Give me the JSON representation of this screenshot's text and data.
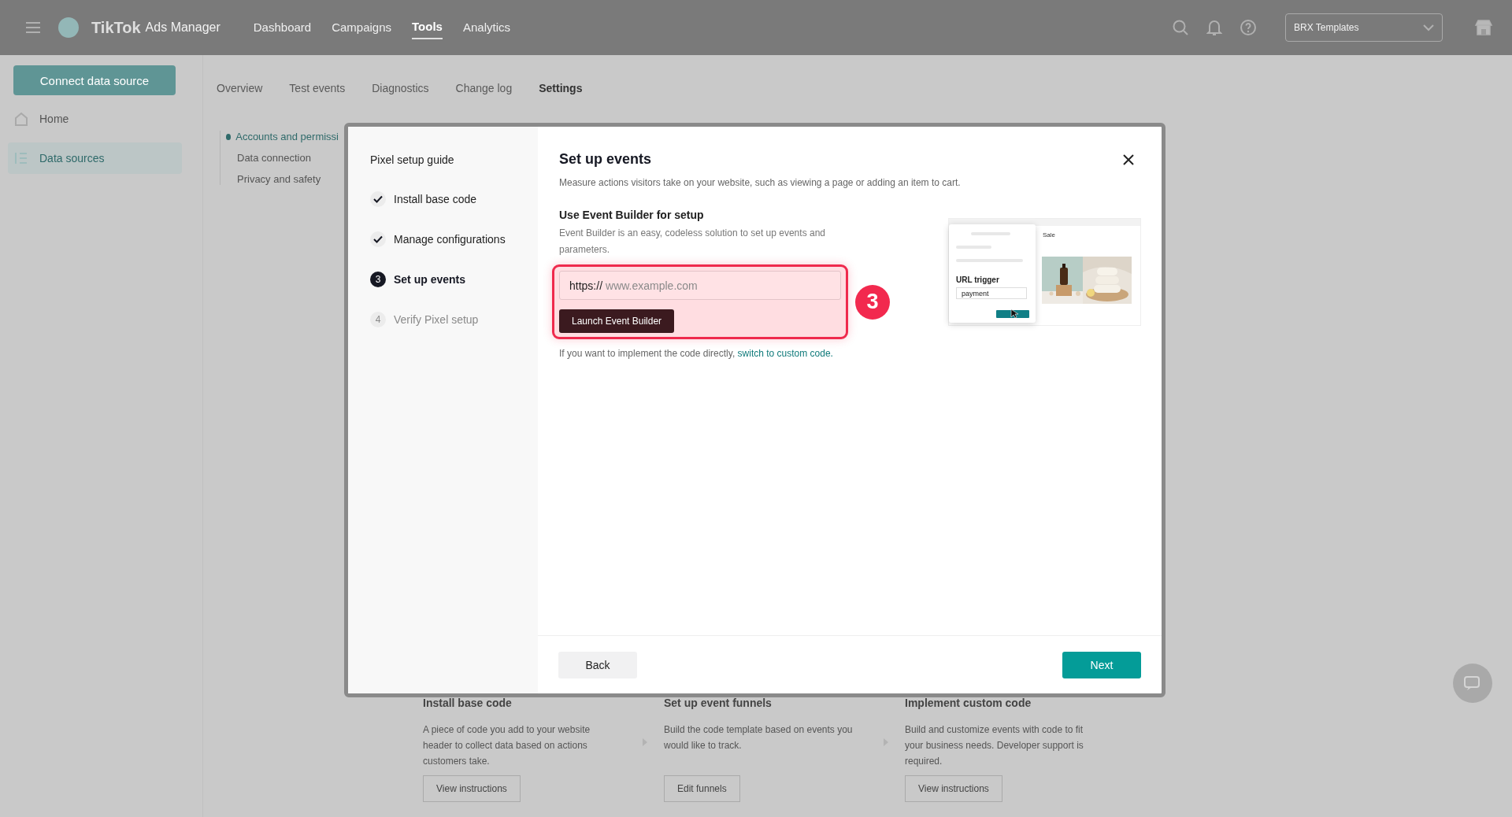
{
  "topbar": {
    "logo": "TikTok",
    "product": "Ads Manager",
    "nav": [
      {
        "label": "Dashboard",
        "selected": false
      },
      {
        "label": "Campaigns",
        "selected": false
      },
      {
        "label": "Tools",
        "selected": true
      },
      {
        "label": "Analytics",
        "selected": false
      }
    ],
    "account": "BRX Templates"
  },
  "subbar": {
    "connect_button": "Connect data source",
    "tabs": [
      {
        "label": "Overview",
        "selected": false
      },
      {
        "label": "Test events",
        "selected": false
      },
      {
        "label": "Diagnostics",
        "selected": false
      },
      {
        "label": "Change log",
        "selected": false
      },
      {
        "label": "Settings",
        "selected": true
      }
    ]
  },
  "sidebar": {
    "items": [
      {
        "kind": "home",
        "label": "Home",
        "selected": false
      },
      {
        "kind": "data",
        "label": "Data sources",
        "selected": true
      }
    ]
  },
  "settings_menu": {
    "items": [
      {
        "label": "Accounts and permissi",
        "selected": true
      },
      {
        "label": "Data connection",
        "selected": false
      },
      {
        "label": "Privacy and safety",
        "selected": false
      }
    ]
  },
  "cards": [
    {
      "title": "Install base code",
      "description": "A piece of code you add to your website header to collect data based on actions customers take.",
      "button": "View instructions"
    },
    {
      "title": "Set up event funnels",
      "description": "Build the code template based on events you would like to track.",
      "button": "Edit funnels"
    },
    {
      "title": "Implement custom code",
      "description": "Build and customize events with code to fit your business needs. Developer support is required.",
      "button": "View instructions"
    }
  ],
  "dialog": {
    "guide_title": "Pixel setup guide",
    "steps": [
      {
        "label": "Install base code",
        "completed": true,
        "selected": false
      },
      {
        "label": "Manage configurations",
        "completed": true,
        "selected": false
      },
      {
        "number": "3",
        "label": "Set up events",
        "completed": false,
        "selected": true
      },
      {
        "number": "4",
        "label": "Verify Pixel setup",
        "completed": false,
        "selected": false
      }
    ],
    "title": "Set up events",
    "subtitle": "Measure actions visitors take on your website, such as viewing a page or adding an item to cart.",
    "section_title": "Use Event Builder for setup",
    "section_text": "Event Builder is an easy, codeless solution to set up events and parameters.",
    "url_prefix": "https://",
    "url_placeholder": "www.example.com",
    "launch_button": "Launch Event Builder",
    "callout_number": "3",
    "footnote": "If you want to implement the code directly, ",
    "footnote_link": "switch to custom code.",
    "illustration": {
      "sale": "Sale",
      "trigger_label": "URL trigger",
      "trigger_value": "payment"
    },
    "back_button": "Back",
    "next_button": "Next"
  }
}
